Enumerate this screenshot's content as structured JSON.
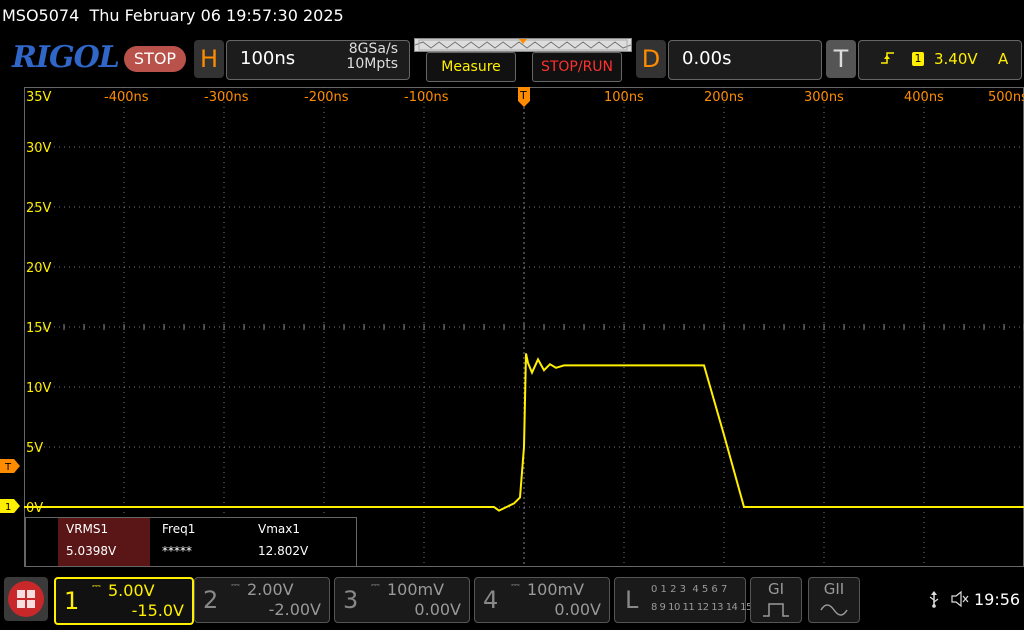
{
  "title_bar": {
    "model": "MSO5074",
    "datetime": "Thu February 06 19:57:30 2025"
  },
  "brand": {
    "logo": "RIGOL",
    "run_state": "STOP"
  },
  "horizontal": {
    "letter": "H",
    "timebase": "100ns",
    "sample_rate": "8GSa/s",
    "memory_depth": "10Mpts"
  },
  "buttons": {
    "measure": "Measure",
    "stop_run": "STOP/RUN"
  },
  "delay": {
    "letter": "D",
    "value": "0.00s"
  },
  "trigger": {
    "letter": "T",
    "edge_icon": "rising-edge-icon",
    "source": "1",
    "level": "3.40V",
    "mode": "A"
  },
  "grid": {
    "time_labels": [
      "-400ns",
      "-300ns",
      "-200ns",
      "-100ns",
      "100ns",
      "200ns",
      "300ns",
      "400ns",
      "500ns"
    ],
    "volt_labels": [
      "35V",
      "30V",
      "25V",
      "20V",
      "15V",
      "10V",
      "5V",
      "0V"
    ],
    "trigger_position_marker": "T",
    "ch1_marker": "1",
    "trigger_level_marker": "T"
  },
  "chart_data": {
    "type": "line",
    "x_unit": "ns",
    "y_unit": "V",
    "xlim": [
      -500,
      500
    ],
    "ylim": [
      -5,
      35
    ],
    "series": [
      {
        "color": "#ffef00",
        "x": [
          -500,
          -30,
          -25,
          -10,
          -4,
          0,
          2,
          4,
          8,
          14,
          20,
          26,
          32,
          40,
          60,
          100,
          150,
          170,
          180,
          200,
          220,
          260,
          500
        ],
        "y": [
          0,
          0,
          -0.3,
          0.3,
          0.8,
          5,
          12.8,
          12.0,
          11.2,
          12.3,
          11.4,
          11.9,
          11.6,
          11.8,
          11.8,
          11.8,
          11.8,
          11.8,
          11.8,
          6,
          0,
          0,
          0
        ]
      }
    ]
  },
  "measurements": [
    {
      "name": "VRMS1",
      "value": "5.0398V"
    },
    {
      "name": "Freq1",
      "value": "*****"
    },
    {
      "name": "Vmax1",
      "value": "12.802V"
    }
  ],
  "channels": [
    {
      "num": "1",
      "scale": "5.00V",
      "offset": "-15.0V",
      "color": "#ffef00"
    },
    {
      "num": "2",
      "scale": "2.00V",
      "offset": "-2.00V",
      "color": "#888888"
    },
    {
      "num": "3",
      "scale": "100mV",
      "offset": "0.00V",
      "color": "#888888"
    },
    {
      "num": "4",
      "scale": "100mV",
      "offset": "0.00V",
      "color": "#888888"
    }
  ],
  "logic": {
    "letter": "L",
    "row1": "0 1 2 3  4 5 6 7",
    "row2": "8 9 10 11 12 13 14 15"
  },
  "decoders": {
    "g1": "GI",
    "g2": "GII"
  },
  "status": {
    "clock": "19:56"
  }
}
